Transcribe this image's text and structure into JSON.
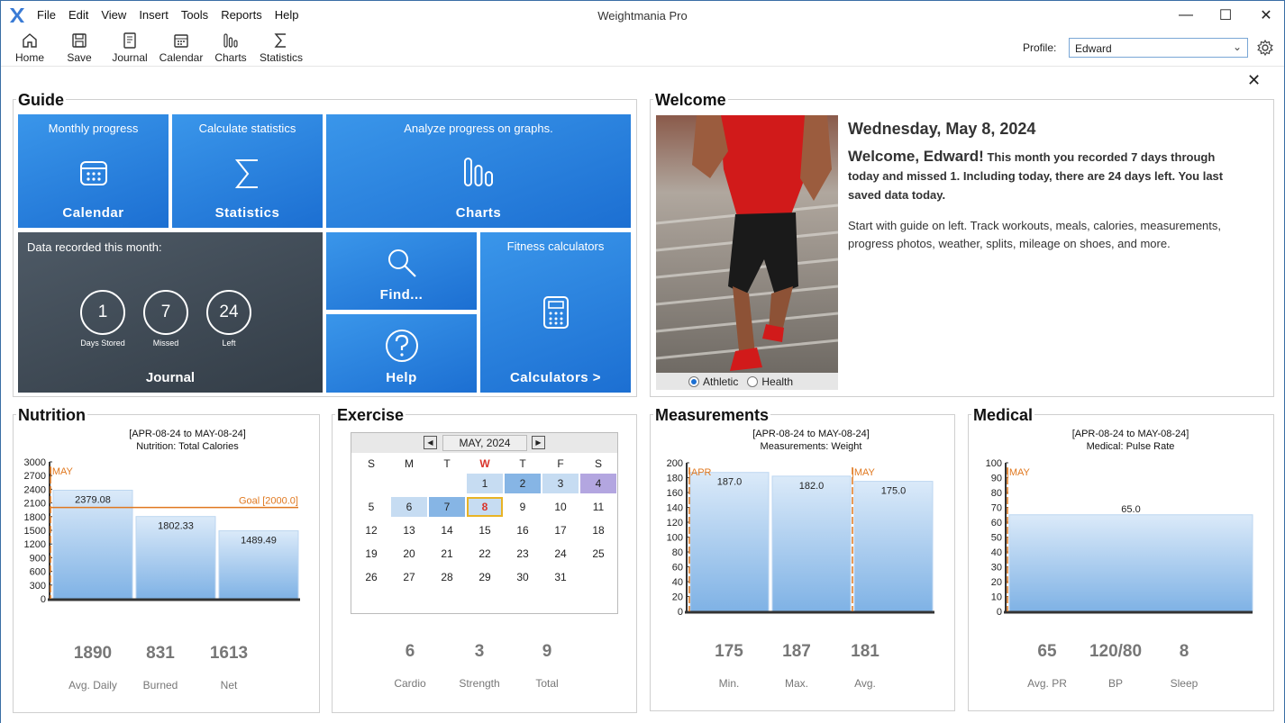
{
  "app": {
    "title": "Weightmania Pro"
  },
  "menu": [
    "File",
    "Edit",
    "View",
    "Insert",
    "Tools",
    "Reports",
    "Help"
  ],
  "toolbar": {
    "home": "Home",
    "save": "Save",
    "journal": "Journal",
    "calendar": "Calendar",
    "charts": "Charts",
    "statistics": "Statistics"
  },
  "profile": {
    "label": "Profile:",
    "value": "Edward"
  },
  "guide": {
    "title": "Guide",
    "calendar_tile": {
      "top": "Monthly progress",
      "bottom": "Calendar"
    },
    "statistics_tile": {
      "top": "Calculate statistics",
      "bottom": "Statistics"
    },
    "charts_tile": {
      "top": "Analyze progress on graphs.",
      "bottom": "Charts"
    },
    "journal_tile": {
      "top": "Data recorded this month:",
      "bottom": "Journal",
      "stats": [
        {
          "value": "1",
          "label": "Days Stored"
        },
        {
          "value": "7",
          "label": "Missed"
        },
        {
          "value": "24",
          "label": "Left"
        }
      ]
    },
    "find_tile": {
      "bottom": "Find..."
    },
    "help_tile": {
      "bottom": "Help"
    },
    "calculators_tile": {
      "top": "Fitness calculators",
      "bottom": "Calculators >"
    }
  },
  "welcome": {
    "title": "Welcome",
    "date": "Wednesday, May 8, 2024",
    "greeting": "Welcome, Edward!",
    "summary": "This month you recorded 7 days through today and missed 1. Including today, there are 24 days left. You last saved data today.",
    "hint": "Start with guide on left. Track workouts, meals, calories, measurements, progress photos, weather, splits, mileage on shoes, and more.",
    "radio_athletic": "Athletic",
    "radio_health": "Health",
    "radio_selected": "Athletic"
  },
  "nutrition": {
    "title": "Nutrition",
    "range": "[APR-08-24 to MAY-08-24]",
    "subtitle": "Nutrition:  Total Calories",
    "stats": [
      {
        "value": "1890",
        "label": "Avg. Daily"
      },
      {
        "value": "831",
        "label": "Burned"
      },
      {
        "value": "1613",
        "label": "Net"
      }
    ]
  },
  "exercise": {
    "title": "Exercise",
    "calendar": {
      "month": "MAY, 2024",
      "dow": [
        "S",
        "M",
        "T",
        "W",
        "T",
        "F",
        "S"
      ],
      "today_dow_index": 3,
      "weeks": [
        [
          "",
          "",
          "",
          "1",
          "2",
          "3",
          "4"
        ],
        [
          "5",
          "6",
          "7",
          "8",
          "9",
          "10",
          "11"
        ],
        [
          "12",
          "13",
          "14",
          "15",
          "16",
          "17",
          "18"
        ],
        [
          "19",
          "20",
          "21",
          "22",
          "23",
          "24",
          "25"
        ],
        [
          "26",
          "27",
          "28",
          "29",
          "30",
          "31",
          ""
        ]
      ],
      "today": "8",
      "light_days": [
        "1",
        "3",
        "6"
      ],
      "medium_days": [
        "2",
        "7"
      ],
      "purple_days": [
        "4"
      ]
    },
    "stats": [
      {
        "value": "6",
        "label": "Cardio"
      },
      {
        "value": "3",
        "label": "Strength"
      },
      {
        "value": "9",
        "label": "Total"
      }
    ]
  },
  "measurements": {
    "title": "Measurements",
    "range": "[APR-08-24 to MAY-08-24]",
    "subtitle": "Measurements:  Weight",
    "stats": [
      {
        "value": "175",
        "label": "Min."
      },
      {
        "value": "187",
        "label": "Max."
      },
      {
        "value": "181",
        "label": "Avg."
      }
    ]
  },
  "medical": {
    "title": "Medical",
    "range": "[APR-08-24 to MAY-08-24]",
    "subtitle": "Medical:  Pulse Rate",
    "stats": [
      {
        "value": "65",
        "label": "Avg. PR"
      },
      {
        "value": "120/80",
        "label": "BP"
      },
      {
        "value": "8",
        "label": "Sleep"
      }
    ]
  },
  "chart_data": [
    {
      "type": "bar",
      "yticks": [
        "3000",
        "2700",
        "2400",
        "2100",
        "1800",
        "1500",
        "1200",
        "900",
        "600",
        "300",
        "0"
      ],
      "ylim": [
        0,
        3000
      ],
      "values": [
        2379.08,
        1802.33,
        1489.49
      ],
      "labels": [
        "2379.08",
        "1802.33",
        "1489.49"
      ],
      "marker": "|MAY",
      "goal": 2000,
      "goal_label": "Goal [2000.0]"
    },
    {
      "type": "bar",
      "yticks": [
        "200",
        "180",
        "160",
        "140",
        "120",
        "100",
        "80",
        "60",
        "40",
        "20",
        "0"
      ],
      "ylim": [
        0,
        200
      ],
      "values": [
        187.0,
        182.0,
        175.0
      ],
      "labels": [
        "187.0",
        "182.0",
        "175.0"
      ],
      "markers": [
        "|APR",
        "|MAY"
      ]
    },
    {
      "type": "bar",
      "yticks": [
        "100",
        "90",
        "80",
        "70",
        "60",
        "50",
        "40",
        "30",
        "20",
        "10",
        "0"
      ],
      "ylim": [
        0,
        100
      ],
      "values": [
        65.0
      ],
      "labels": [
        "65.0"
      ],
      "marker": "|MAY"
    }
  ]
}
